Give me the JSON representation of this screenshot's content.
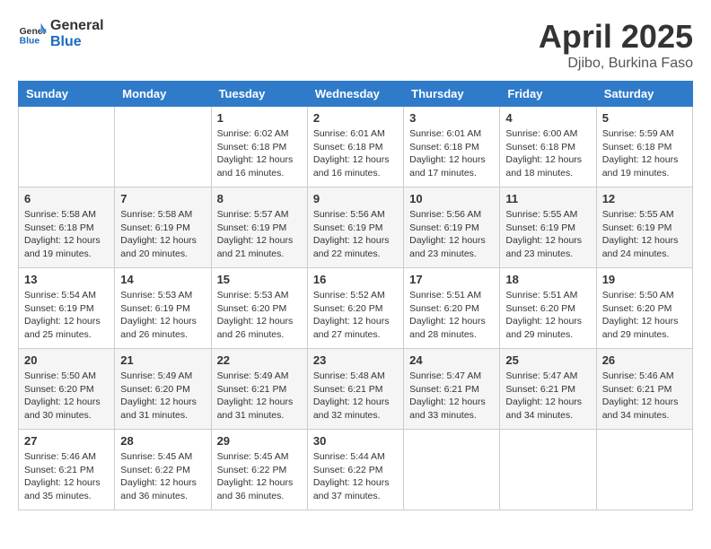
{
  "header": {
    "logo_line1": "General",
    "logo_line2": "Blue",
    "month_title": "April 2025",
    "subtitle": "Djibo, Burkina Faso"
  },
  "days_of_week": [
    "Sunday",
    "Monday",
    "Tuesday",
    "Wednesday",
    "Thursday",
    "Friday",
    "Saturday"
  ],
  "weeks": [
    [
      {
        "day": "",
        "info": ""
      },
      {
        "day": "",
        "info": ""
      },
      {
        "day": "1",
        "info": "Sunrise: 6:02 AM\nSunset: 6:18 PM\nDaylight: 12 hours and 16 minutes."
      },
      {
        "day": "2",
        "info": "Sunrise: 6:01 AM\nSunset: 6:18 PM\nDaylight: 12 hours and 16 minutes."
      },
      {
        "day": "3",
        "info": "Sunrise: 6:01 AM\nSunset: 6:18 PM\nDaylight: 12 hours and 17 minutes."
      },
      {
        "day": "4",
        "info": "Sunrise: 6:00 AM\nSunset: 6:18 PM\nDaylight: 12 hours and 18 minutes."
      },
      {
        "day": "5",
        "info": "Sunrise: 5:59 AM\nSunset: 6:18 PM\nDaylight: 12 hours and 19 minutes."
      }
    ],
    [
      {
        "day": "6",
        "info": "Sunrise: 5:58 AM\nSunset: 6:18 PM\nDaylight: 12 hours and 19 minutes."
      },
      {
        "day": "7",
        "info": "Sunrise: 5:58 AM\nSunset: 6:19 PM\nDaylight: 12 hours and 20 minutes."
      },
      {
        "day": "8",
        "info": "Sunrise: 5:57 AM\nSunset: 6:19 PM\nDaylight: 12 hours and 21 minutes."
      },
      {
        "day": "9",
        "info": "Sunrise: 5:56 AM\nSunset: 6:19 PM\nDaylight: 12 hours and 22 minutes."
      },
      {
        "day": "10",
        "info": "Sunrise: 5:56 AM\nSunset: 6:19 PM\nDaylight: 12 hours and 23 minutes."
      },
      {
        "day": "11",
        "info": "Sunrise: 5:55 AM\nSunset: 6:19 PM\nDaylight: 12 hours and 23 minutes."
      },
      {
        "day": "12",
        "info": "Sunrise: 5:55 AM\nSunset: 6:19 PM\nDaylight: 12 hours and 24 minutes."
      }
    ],
    [
      {
        "day": "13",
        "info": "Sunrise: 5:54 AM\nSunset: 6:19 PM\nDaylight: 12 hours and 25 minutes."
      },
      {
        "day": "14",
        "info": "Sunrise: 5:53 AM\nSunset: 6:19 PM\nDaylight: 12 hours and 26 minutes."
      },
      {
        "day": "15",
        "info": "Sunrise: 5:53 AM\nSunset: 6:20 PM\nDaylight: 12 hours and 26 minutes."
      },
      {
        "day": "16",
        "info": "Sunrise: 5:52 AM\nSunset: 6:20 PM\nDaylight: 12 hours and 27 minutes."
      },
      {
        "day": "17",
        "info": "Sunrise: 5:51 AM\nSunset: 6:20 PM\nDaylight: 12 hours and 28 minutes."
      },
      {
        "day": "18",
        "info": "Sunrise: 5:51 AM\nSunset: 6:20 PM\nDaylight: 12 hours and 29 minutes."
      },
      {
        "day": "19",
        "info": "Sunrise: 5:50 AM\nSunset: 6:20 PM\nDaylight: 12 hours and 29 minutes."
      }
    ],
    [
      {
        "day": "20",
        "info": "Sunrise: 5:50 AM\nSunset: 6:20 PM\nDaylight: 12 hours and 30 minutes."
      },
      {
        "day": "21",
        "info": "Sunrise: 5:49 AM\nSunset: 6:20 PM\nDaylight: 12 hours and 31 minutes."
      },
      {
        "day": "22",
        "info": "Sunrise: 5:49 AM\nSunset: 6:21 PM\nDaylight: 12 hours and 31 minutes."
      },
      {
        "day": "23",
        "info": "Sunrise: 5:48 AM\nSunset: 6:21 PM\nDaylight: 12 hours and 32 minutes."
      },
      {
        "day": "24",
        "info": "Sunrise: 5:47 AM\nSunset: 6:21 PM\nDaylight: 12 hours and 33 minutes."
      },
      {
        "day": "25",
        "info": "Sunrise: 5:47 AM\nSunset: 6:21 PM\nDaylight: 12 hours and 34 minutes."
      },
      {
        "day": "26",
        "info": "Sunrise: 5:46 AM\nSunset: 6:21 PM\nDaylight: 12 hours and 34 minutes."
      }
    ],
    [
      {
        "day": "27",
        "info": "Sunrise: 5:46 AM\nSunset: 6:21 PM\nDaylight: 12 hours and 35 minutes."
      },
      {
        "day": "28",
        "info": "Sunrise: 5:45 AM\nSunset: 6:22 PM\nDaylight: 12 hours and 36 minutes."
      },
      {
        "day": "29",
        "info": "Sunrise: 5:45 AM\nSunset: 6:22 PM\nDaylight: 12 hours and 36 minutes."
      },
      {
        "day": "30",
        "info": "Sunrise: 5:44 AM\nSunset: 6:22 PM\nDaylight: 12 hours and 37 minutes."
      },
      {
        "day": "",
        "info": ""
      },
      {
        "day": "",
        "info": ""
      },
      {
        "day": "",
        "info": ""
      }
    ]
  ]
}
